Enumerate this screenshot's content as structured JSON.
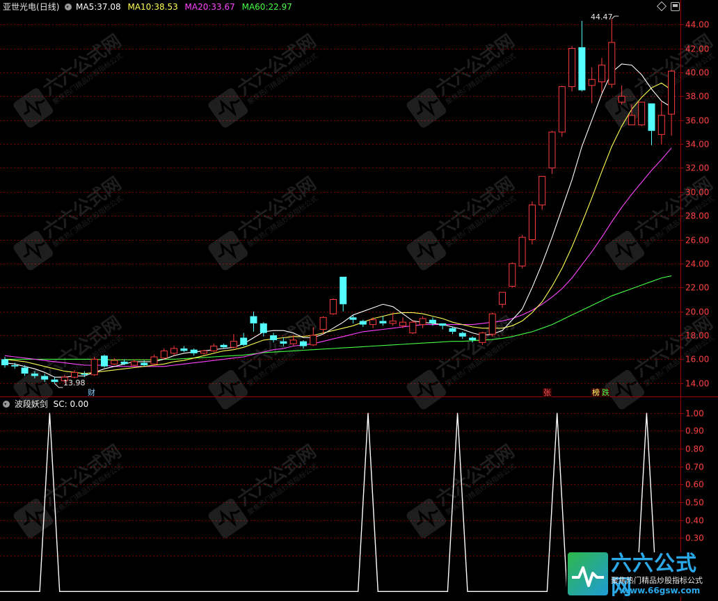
{
  "header": {
    "stock_name": "亚世光电",
    "period": "(日线)",
    "ma": [
      {
        "label": "MA5:",
        "value": "37.08",
        "color": "#ffffff"
      },
      {
        "label": "MA10:",
        "value": "38.53",
        "color": "#ffff55"
      },
      {
        "label": "MA20:",
        "value": "33.67",
        "color": "#ff44ff"
      },
      {
        "label": "MA60:",
        "value": "22.97",
        "color": "#44ff44"
      }
    ]
  },
  "indicator": {
    "name": "波段妖剑",
    "value_text": "SC: 0.00"
  },
  "markers": {
    "cai": "财",
    "zhang": "张",
    "bang": "榜",
    "die": "跌"
  },
  "watermark": {
    "cn": "六六公式网",
    "tagline": "聚焦热门精品炒股指标公式",
    "url": "www.66gsw.com"
  },
  "colors": {
    "up": "#ff3b3b",
    "down": "#54ffff",
    "ma5": "#ffffff",
    "ma10": "#ffff55",
    "ma20": "#ff44ff",
    "ma60": "#44ff44",
    "grid": "#800000",
    "axis_text": "#ff4040",
    "indicator": "#ffffff"
  },
  "chart_data": [
    {
      "type": "candlestick",
      "title": "亚世光电(日线)",
      "y_ticks": [
        14,
        16,
        18,
        20,
        22,
        24,
        26,
        28,
        30,
        32,
        34,
        36,
        38,
        40,
        42,
        44
      ],
      "y_tick_labels": [
        "14.00",
        "16.00",
        "18.00",
        "20.00",
        "22.00",
        "24.00",
        "26.00",
        "28.00",
        "30.00",
        "32.00",
        "34.00",
        "36.00",
        "38.00",
        "40.00",
        "42.00",
        "44.00"
      ],
      "ylim": [
        13,
        45
      ],
      "annotations": [
        {
          "text": "44.47",
          "kind": "high",
          "index": 61,
          "value": 44.47
        },
        {
          "text": "13.98",
          "kind": "low",
          "index": 5,
          "value": 13.98
        }
      ],
      "candles": [
        [
          16.0,
          15.5,
          16.2,
          15.3
        ],
        [
          15.5,
          15.4,
          15.7,
          15.2
        ],
        [
          15.3,
          14.8,
          15.5,
          14.6
        ],
        [
          14.8,
          14.6,
          15.0,
          14.4
        ],
        [
          14.6,
          14.3,
          14.8,
          14.1
        ],
        [
          14.3,
          14.1,
          14.5,
          13.98
        ],
        [
          14.2,
          14.5,
          14.7,
          14.0
        ],
        [
          14.5,
          14.9,
          15.1,
          14.4
        ],
        [
          14.8,
          14.7,
          15.0,
          14.5
        ],
        [
          14.7,
          16.0,
          16.2,
          14.6
        ],
        [
          16.3,
          15.4,
          16.4,
          15.3
        ],
        [
          15.6,
          15.9,
          16.1,
          15.5
        ],
        [
          15.8,
          15.6,
          16.0,
          15.5
        ],
        [
          15.5,
          15.8,
          16.0,
          15.4
        ],
        [
          15.7,
          15.5,
          15.9,
          15.4
        ],
        [
          15.6,
          16.2,
          16.4,
          15.5
        ],
        [
          16.1,
          16.7,
          16.9,
          16.0
        ],
        [
          16.5,
          16.9,
          17.1,
          16.3
        ],
        [
          16.9,
          16.7,
          17.1,
          16.6
        ],
        [
          16.8,
          16.5,
          16.9,
          16.3
        ],
        [
          16.5,
          16.7,
          16.8,
          16.4
        ],
        [
          16.7,
          17.1,
          17.3,
          16.6
        ],
        [
          17.2,
          17.0,
          17.3,
          16.9
        ],
        [
          17.0,
          17.5,
          18.1,
          16.9
        ],
        [
          17.8,
          17.2,
          18.2,
          17.1
        ],
        [
          19.6,
          19.0,
          20.0,
          18.3
        ],
        [
          19.0,
          18.2,
          19.1,
          17.9
        ],
        [
          18.0,
          17.6,
          18.2,
          17.4
        ],
        [
          17.5,
          17.3,
          17.8,
          17.1
        ],
        [
          17.3,
          17.6,
          18.0,
          17.1
        ],
        [
          17.5,
          17.1,
          17.6,
          16.9
        ],
        [
          17.2,
          18.0,
          18.7,
          17.1
        ],
        [
          18.5,
          19.5,
          19.6,
          18.1
        ],
        [
          19.8,
          21.0,
          21.1,
          19.7
        ],
        [
          22.9,
          20.6,
          22.9,
          20.0
        ],
        [
          19.5,
          19.3,
          19.7,
          19.0
        ],
        [
          19.2,
          18.9,
          19.3,
          18.7
        ],
        [
          18.9,
          19.3,
          19.5,
          18.6
        ],
        [
          19.2,
          19.0,
          19.6,
          18.8
        ],
        [
          19.0,
          19.2,
          19.9,
          18.8
        ],
        [
          18.8,
          19.1,
          19.5,
          18.6
        ],
        [
          18.2,
          19.1,
          19.3,
          18.1
        ],
        [
          18.9,
          19.4,
          19.6,
          18.6
        ],
        [
          19.3,
          19.0,
          19.5,
          18.8
        ],
        [
          19.0,
          18.8,
          19.0,
          18.5
        ],
        [
          18.6,
          18.3,
          18.7,
          18.1
        ],
        [
          18.2,
          17.9,
          18.3,
          17.7
        ],
        [
          17.8,
          17.6,
          17.9,
          17.4
        ],
        [
          17.4,
          18.2,
          18.3,
          17.2
        ],
        [
          18.1,
          19.8,
          19.9,
          17.9
        ],
        [
          20.6,
          21.6,
          21.6,
          20.3
        ],
        [
          22.1,
          24.0,
          24.1,
          22.0
        ],
        [
          23.8,
          26.2,
          26.4,
          23.6
        ],
        [
          26.0,
          28.9,
          29.2,
          25.6
        ],
        [
          28.9,
          31.3,
          31.3,
          28.5
        ],
        [
          32.0,
          35.0,
          35.1,
          31.5
        ],
        [
          35.0,
          38.8,
          38.9,
          34.6
        ],
        [
          38.8,
          42.0,
          42.2,
          38.4
        ],
        [
          42.1,
          38.5,
          44.3,
          38.4
        ],
        [
          38.9,
          39.4,
          40.4,
          37.4
        ],
        [
          39.2,
          40.6,
          41.2,
          38.3
        ],
        [
          39.0,
          42.5,
          44.47,
          38.7
        ],
        [
          37.5,
          38.0,
          38.9,
          37.3
        ],
        [
          35.6,
          36.4,
          37.3,
          35.6
        ],
        [
          35.6,
          37.5,
          37.5,
          35.5
        ],
        [
          37.4,
          35.1,
          37.4,
          33.9
        ],
        [
          34.8,
          36.4,
          37.6,
          34.0
        ],
        [
          36.5,
          40.1,
          40.2,
          34.7
        ]
      ],
      "ma5": [
        15.7,
        15.6,
        15.4,
        15.2,
        14.9,
        14.5,
        14.5,
        14.6,
        14.6,
        14.9,
        15.2,
        15.4,
        15.6,
        15.8,
        15.8,
        15.8,
        16.0,
        16.3,
        16.5,
        16.6,
        16.7,
        16.8,
        16.9,
        17.0,
        17.3,
        17.8,
        18.3,
        18.4,
        18.4,
        18.2,
        17.8,
        17.8,
        18.1,
        18.6,
        19.1,
        19.7,
        20.0,
        20.3,
        20.6,
        20.4,
        19.8,
        19.2,
        19.1,
        19.0,
        18.9,
        18.7,
        18.5,
        18.2,
        18.0,
        18.1,
        18.4,
        19.3,
        20.2,
        22.0,
        24.0,
        26.2,
        28.6,
        31.0,
        33.8,
        36.0,
        38.2,
        40.0,
        40.7,
        40.6,
        39.8,
        38.6,
        37.6,
        37.08
      ],
      "ma10": [
        16.0,
        15.9,
        15.8,
        15.6,
        15.4,
        15.2,
        15.0,
        14.9,
        14.8,
        14.9,
        15.0,
        15.1,
        15.2,
        15.3,
        15.4,
        15.5,
        15.6,
        15.8,
        15.9,
        16.1,
        16.3,
        16.5,
        16.7,
        16.8,
        17.0,
        17.3,
        17.6,
        17.7,
        17.8,
        17.9,
        17.9,
        18.0,
        18.2,
        18.4,
        18.6,
        18.8,
        19.1,
        19.4,
        19.6,
        19.8,
        19.9,
        19.9,
        19.8,
        19.6,
        19.4,
        19.1,
        18.9,
        18.7,
        18.6,
        18.6,
        18.6,
        18.8,
        19.2,
        19.9,
        20.8,
        22.1,
        23.6,
        25.4,
        27.4,
        29.5,
        31.7,
        33.8,
        35.5,
        36.9,
        37.9,
        38.7,
        39.1,
        38.53
      ],
      "ma20": [
        16.3,
        16.2,
        16.1,
        16.0,
        15.9,
        15.8,
        15.7,
        15.6,
        15.5,
        15.5,
        15.5,
        15.4,
        15.4,
        15.4,
        15.4,
        15.4,
        15.4,
        15.5,
        15.6,
        15.7,
        15.8,
        15.9,
        16.0,
        16.1,
        16.2,
        16.4,
        16.6,
        16.8,
        16.9,
        17.1,
        17.2,
        17.3,
        17.5,
        17.7,
        17.9,
        18.1,
        18.3,
        18.4,
        18.5,
        18.6,
        18.7,
        18.8,
        18.9,
        18.9,
        18.9,
        18.9,
        18.9,
        18.9,
        19.0,
        19.1,
        19.2,
        19.4,
        19.7,
        20.1,
        20.6,
        21.2,
        21.9,
        22.8,
        23.9,
        25.0,
        26.2,
        27.5,
        28.7,
        29.8,
        30.8,
        31.8,
        32.7,
        33.67
      ],
      "ma60": [
        16.0,
        16.0,
        16.0,
        16.0,
        16.0,
        16.0,
        16.0,
        16.0,
        16.0,
        16.0,
        15.95,
        15.95,
        15.95,
        15.95,
        15.95,
        15.95,
        16.0,
        16.0,
        16.05,
        16.1,
        16.15,
        16.2,
        16.25,
        16.3,
        16.35,
        16.45,
        16.55,
        16.6,
        16.65,
        16.7,
        16.75,
        16.8,
        16.85,
        16.9,
        16.95,
        17.0,
        17.05,
        17.1,
        17.15,
        17.2,
        17.25,
        17.3,
        17.35,
        17.4,
        17.45,
        17.5,
        17.5,
        17.55,
        17.6,
        17.65,
        17.75,
        17.9,
        18.1,
        18.3,
        18.6,
        18.9,
        19.3,
        19.7,
        20.1,
        20.5,
        20.9,
        21.3,
        21.6,
        21.9,
        22.2,
        22.5,
        22.8,
        22.97
      ]
    },
    {
      "type": "line",
      "title": "波段妖剑",
      "series": [
        {
          "name": "SC",
          "values": [
            0,
            0,
            0,
            0,
            0,
            1,
            0,
            0,
            0,
            0,
            0,
            0,
            0,
            0,
            0,
            0,
            0,
            0,
            0,
            0,
            0,
            0,
            0,
            0,
            0,
            0,
            0,
            0,
            0,
            0,
            0,
            0,
            0,
            0,
            0,
            0,
            0,
            1,
            0,
            0,
            0,
            0,
            0,
            0,
            0,
            0,
            1,
            0,
            0,
            0,
            0,
            0,
            0,
            0,
            0,
            0,
            1,
            0,
            0,
            0,
            0,
            0,
            0,
            0,
            0,
            1,
            0,
            0,
            0,
            0,
            0
          ]
        }
      ],
      "y_ticks": [
        0.2,
        0.3,
        0.4,
        0.5,
        0.6,
        0.7,
        0.8,
        0.9,
        1.0
      ],
      "y_tick_labels": [
        "0.20",
        "0.30",
        "0.40",
        "0.50",
        "0.60",
        "0.70",
        "0.80",
        "0.90",
        "1.00"
      ],
      "ylim": [
        -0.03,
        1.03
      ]
    }
  ]
}
